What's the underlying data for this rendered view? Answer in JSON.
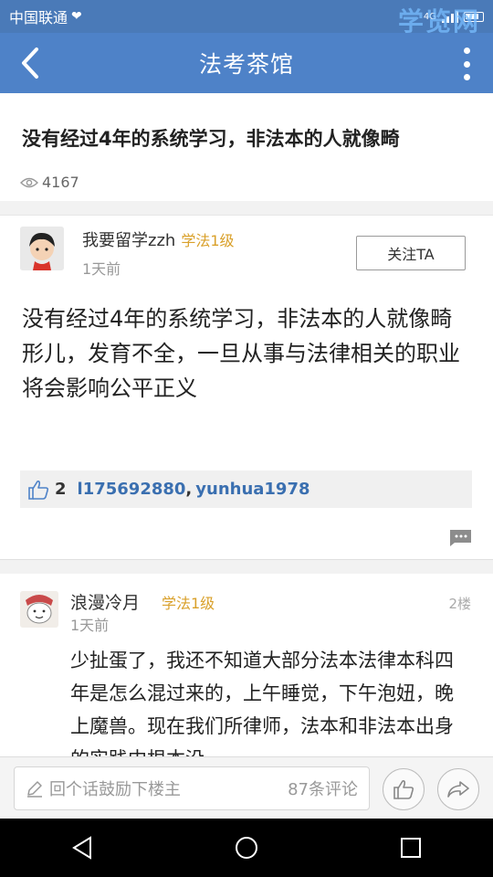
{
  "status_bar": {
    "carrier": "中国联通",
    "network": "4G",
    "watermark": "学览网"
  },
  "header": {
    "title": "法考茶馆"
  },
  "topic": {
    "title": "没有经过4年的系统学习，非法本的人就像畸",
    "views": "4167"
  },
  "post": {
    "author": "我要留学zzh",
    "level": "学法1级",
    "time": "1天前",
    "follow_label": "关注TA",
    "content": "没有经过4年的系统学习，非法本的人就像畸形儿，发育不全，一旦从事与法律相关的职业将会影响公平正义",
    "likes": {
      "count": "2",
      "users": [
        "l175692880",
        "yunhua1978"
      ]
    }
  },
  "reply": {
    "author": "浪漫冷月",
    "level": "学法1级",
    "floor": "2楼",
    "time": "1天前",
    "content": "少扯蛋了，我还不知道大部分法本法律本科四年是怎么混过来的，上午睡觉，下午泡妞，晚上魔兽。现在我们所律师，法本和非法本出身的实践中根本没"
  },
  "bottom_bar": {
    "placeholder": "回个话鼓励下楼主",
    "comment_count": "87条评论"
  },
  "colors": {
    "header_bg": "#4e82c8",
    "level_color": "#d9a02a",
    "link_color": "#3a6fb0"
  }
}
